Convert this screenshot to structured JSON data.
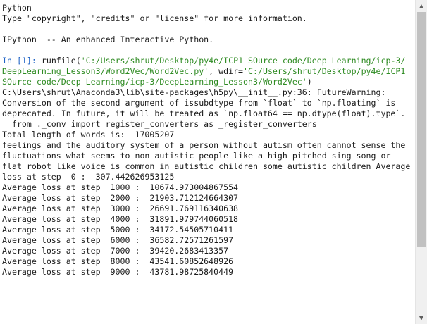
{
  "console": {
    "banner_line1": "Python",
    "banner_line2": "Type \"copyright\", \"credits\" or \"license\" for more information.",
    "ipython_banner": "IPython  -- An enhanced Interactive Python.",
    "prompt": "In [1]:",
    "cmd_func": " runfile(",
    "cmd_path_part1": "'C:/Users/shrut/Desktop/py4e/ICP1 SOurce code/Deep Learning/icp-3/",
    "cmd_path_part2": "DeepLearning_Lesson3/Word2Vec/Word2Vec.py'",
    "cmd_wdir_label": ", wdir=",
    "cmd_wdir_part1": "'C:/Users/shrut/Desktop/py4e/ICP1",
    "cmd_wdir_part2": "SOurce code/Deep Learning/icp-3/DeepLearning_Lesson3/Word2Vec'",
    "cmd_close": ")",
    "warning_line1": "C:\\Users\\shrut\\Anaconda3\\lib\\site-packages\\h5py\\__init__.py:36: FutureWarning:",
    "warning_line2": "Conversion of the second argument of issubdtype from `float` to `np.floating` is",
    "warning_line3": "deprecated. In future, it will be treated as `np.float64 == np.dtype(float).type`.",
    "warning_line4": "  from ._conv import register_converters as _register_converters",
    "total_length_line": "Total length of words is:  17005207",
    "text_line1": "feelings and the auditory system of a person without autism often cannot sense the",
    "text_line2": "fluctuations what seems to non autistic people like a high pitched sing song or",
    "text_line3": "flat robot like voice is common in autistic children some autistic children Average",
    "loss_step0": "loss at step  0 :  307.442626953125",
    "loss_lines": [
      "Average loss at step  1000 :  10674.973004867554",
      "Average loss at step  2000 :  21903.712124664307",
      "Average loss at step  3000 :  26691.769116340638",
      "Average loss at step  4000 :  31891.979744060518",
      "Average loss at step  5000 :  34172.54505710411",
      "Average loss at step  6000 :  36582.72571261597",
      "Average loss at step  7000 :  39420.2683413357",
      "Average loss at step  8000 :  43541.60852648926",
      "Average loss at step  9000 :  43781.98725840449"
    ]
  },
  "scrollbar": {
    "up_arrow": "▲",
    "down_arrow": "▼",
    "position_fraction": 0.0
  }
}
